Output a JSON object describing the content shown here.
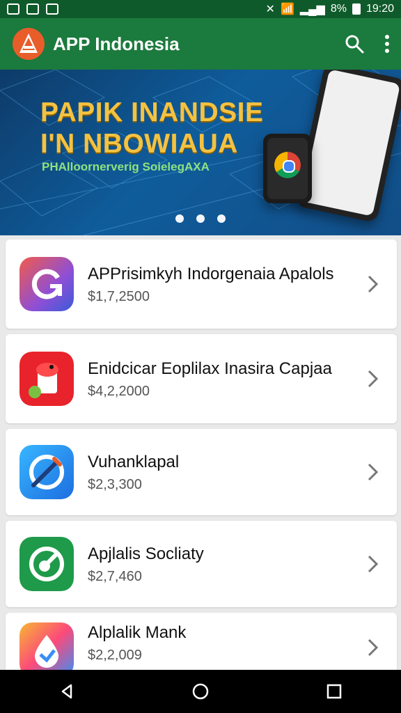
{
  "status": {
    "battery_pct": "8%",
    "time": "19:20"
  },
  "appbar": {
    "title": "APP Indonesia"
  },
  "banner": {
    "title_line1": "PAPIK INANDSIE",
    "title_line2": "I'N NBOWIAUA",
    "subtitle": "PHAlloornerverig SoielegAXA",
    "carousel_pages": 3
  },
  "apps": [
    {
      "name": "APPrisimkyh Indorgenaia Apalols",
      "price": "$1,7,2500"
    },
    {
      "name": "Enidcicar Eoplilax Inasira Capjaa",
      "price": "$4,2,2000"
    },
    {
      "name": "Vuhanklapal",
      "price": "$2,3,300"
    },
    {
      "name": "Apjlalis Socliaty",
      "price": "$2,7,460"
    },
    {
      "name": "Alplalik Mank",
      "price": "$2,2,009"
    }
  ],
  "colors": {
    "appbar": "#1b7a3d",
    "status": "#0f5a2a",
    "banner": "#0f5c9b",
    "accent": "#f4c242"
  }
}
